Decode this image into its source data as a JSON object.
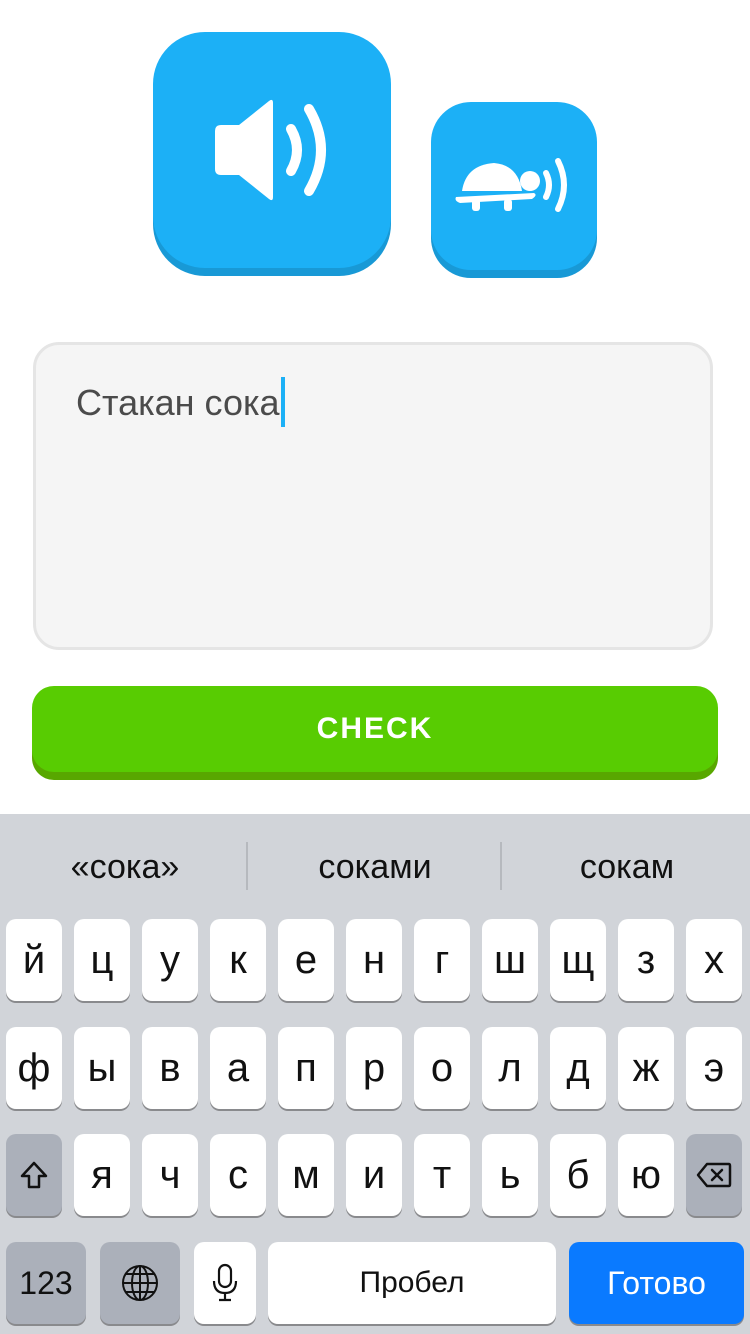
{
  "audio": {
    "normal_icon": "speaker-icon",
    "slow_icon": "turtle-speaker-icon"
  },
  "answer": {
    "text": "Стакан сока"
  },
  "check_button": {
    "label": "CHECK",
    "color": "#58cc02"
  },
  "keyboard": {
    "suggestions": [
      "«сока»",
      "соками",
      "сокам"
    ],
    "rows": [
      [
        "й",
        "ц",
        "у",
        "к",
        "е",
        "н",
        "г",
        "ш",
        "щ",
        "з",
        "х"
      ],
      [
        "ф",
        "ы",
        "в",
        "а",
        "п",
        "р",
        "о",
        "л",
        "д",
        "ж",
        "э"
      ],
      [
        "я",
        "ч",
        "с",
        "м",
        "и",
        "т",
        "ь",
        "б",
        "ю"
      ]
    ],
    "shift_icon": "shift-icon",
    "backspace_icon": "backspace-icon",
    "numbers_label": "123",
    "globe_icon": "globe-icon",
    "mic_icon": "microphone-icon",
    "space_label": "Пробел",
    "done_label": "Готово",
    "done_color": "#0a7aff"
  }
}
